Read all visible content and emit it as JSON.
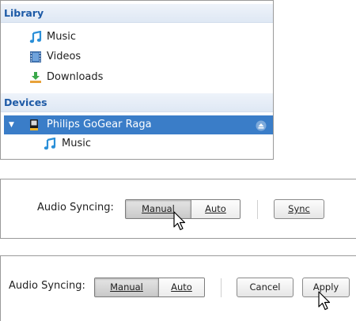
{
  "library": {
    "header": "Library",
    "items": [
      {
        "label": "Music",
        "icon": "music-note-icon"
      },
      {
        "label": "Videos",
        "icon": "film-icon"
      },
      {
        "label": "Downloads",
        "icon": "download-icon"
      }
    ]
  },
  "devices": {
    "header": "Devices",
    "device": {
      "label": "Philips GoGear Raga",
      "icon": "media-player-icon",
      "expanded": true,
      "eject_icon": "eject-icon"
    },
    "children": [
      {
        "label": "Music",
        "icon": "music-note-icon"
      }
    ]
  },
  "sync_panel_1": {
    "label": "Audio Syncing:",
    "manual": "Manual",
    "auto": "Auto",
    "selected": "Manual",
    "sync_button": "Sync"
  },
  "sync_panel_2": {
    "label": "Audio Syncing:",
    "manual": "Manual",
    "auto": "Auto",
    "selected": "Manual",
    "cancel_button": "Cancel",
    "apply_button": "Apply"
  },
  "colors": {
    "header_text": "#1d5aa6",
    "selection": "#3a7dc8",
    "music_icon": "#2a8fd8",
    "download_icon": "#3aa84a"
  }
}
